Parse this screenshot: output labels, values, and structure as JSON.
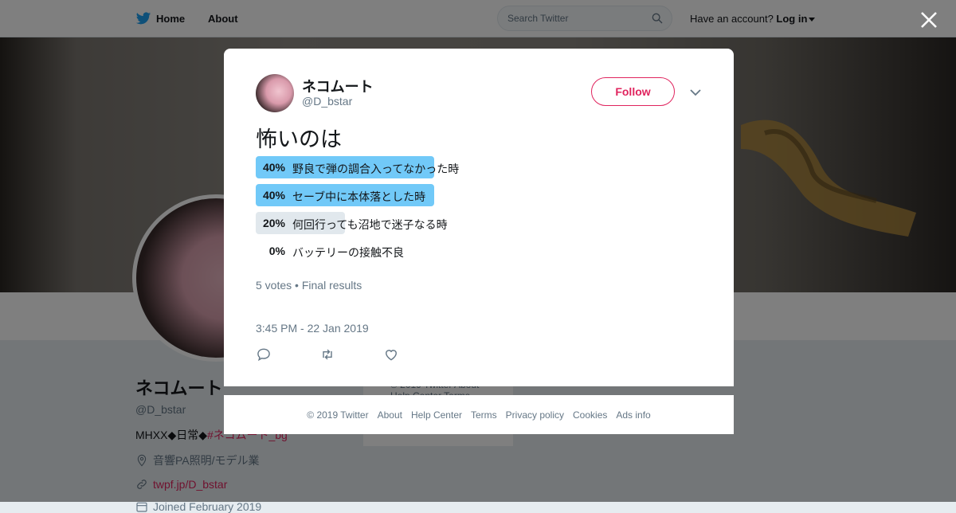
{
  "topbar": {
    "home_label": "Home",
    "about_label": "About",
    "search_placeholder": "Search Twitter",
    "account_prompt": "Have an account?",
    "login_label": "Log in"
  },
  "profile": {
    "name": "ネコムート",
    "handle": "@D_bstar",
    "bio_prefix": "MHXX◆日常◆",
    "bio_hashtag": "#ネコムート_bg",
    "location": "音響PA照明/モデル業",
    "website": "twpf.jp/D_bstar",
    "joined": "Joined February 2019"
  },
  "behind_card": {
    "line1": "© 2019 Twitter  About",
    "line2": "Help Center  Terms"
  },
  "tweet": {
    "author_name": "ネコムート",
    "author_handle": "@D_bstar",
    "follow_label": "Follow",
    "text": "怖いのは",
    "poll": [
      {
        "percent": "40%",
        "fraction": 0.4,
        "label": "野良で弾の調合入ってなかった時",
        "winner": true
      },
      {
        "percent": "40%",
        "fraction": 0.4,
        "label": "セーブ中に本体落とした時",
        "winner": true
      },
      {
        "percent": "20%",
        "fraction": 0.2,
        "label": "何回行っても沼地で迷子なる時",
        "winner": false
      },
      {
        "percent": "0%",
        "fraction": 0.0,
        "label": "バッテリーの接触不良",
        "winner": false
      }
    ],
    "votes": "5 votes",
    "results_status": "Final results",
    "timestamp": "3:45 PM - 22 Jan 2019"
  },
  "footer": {
    "copyright": "© 2019 Twitter",
    "about": "About",
    "help": "Help Center",
    "terms": "Terms",
    "privacy": "Privacy policy",
    "cookies": "Cookies",
    "ads": "Ads info"
  },
  "colors": {
    "accent": "#e0245e",
    "poll_winner": "#71c9f8",
    "poll_other": "#e1e8ed",
    "twitter_blue": "#1da1f2"
  }
}
